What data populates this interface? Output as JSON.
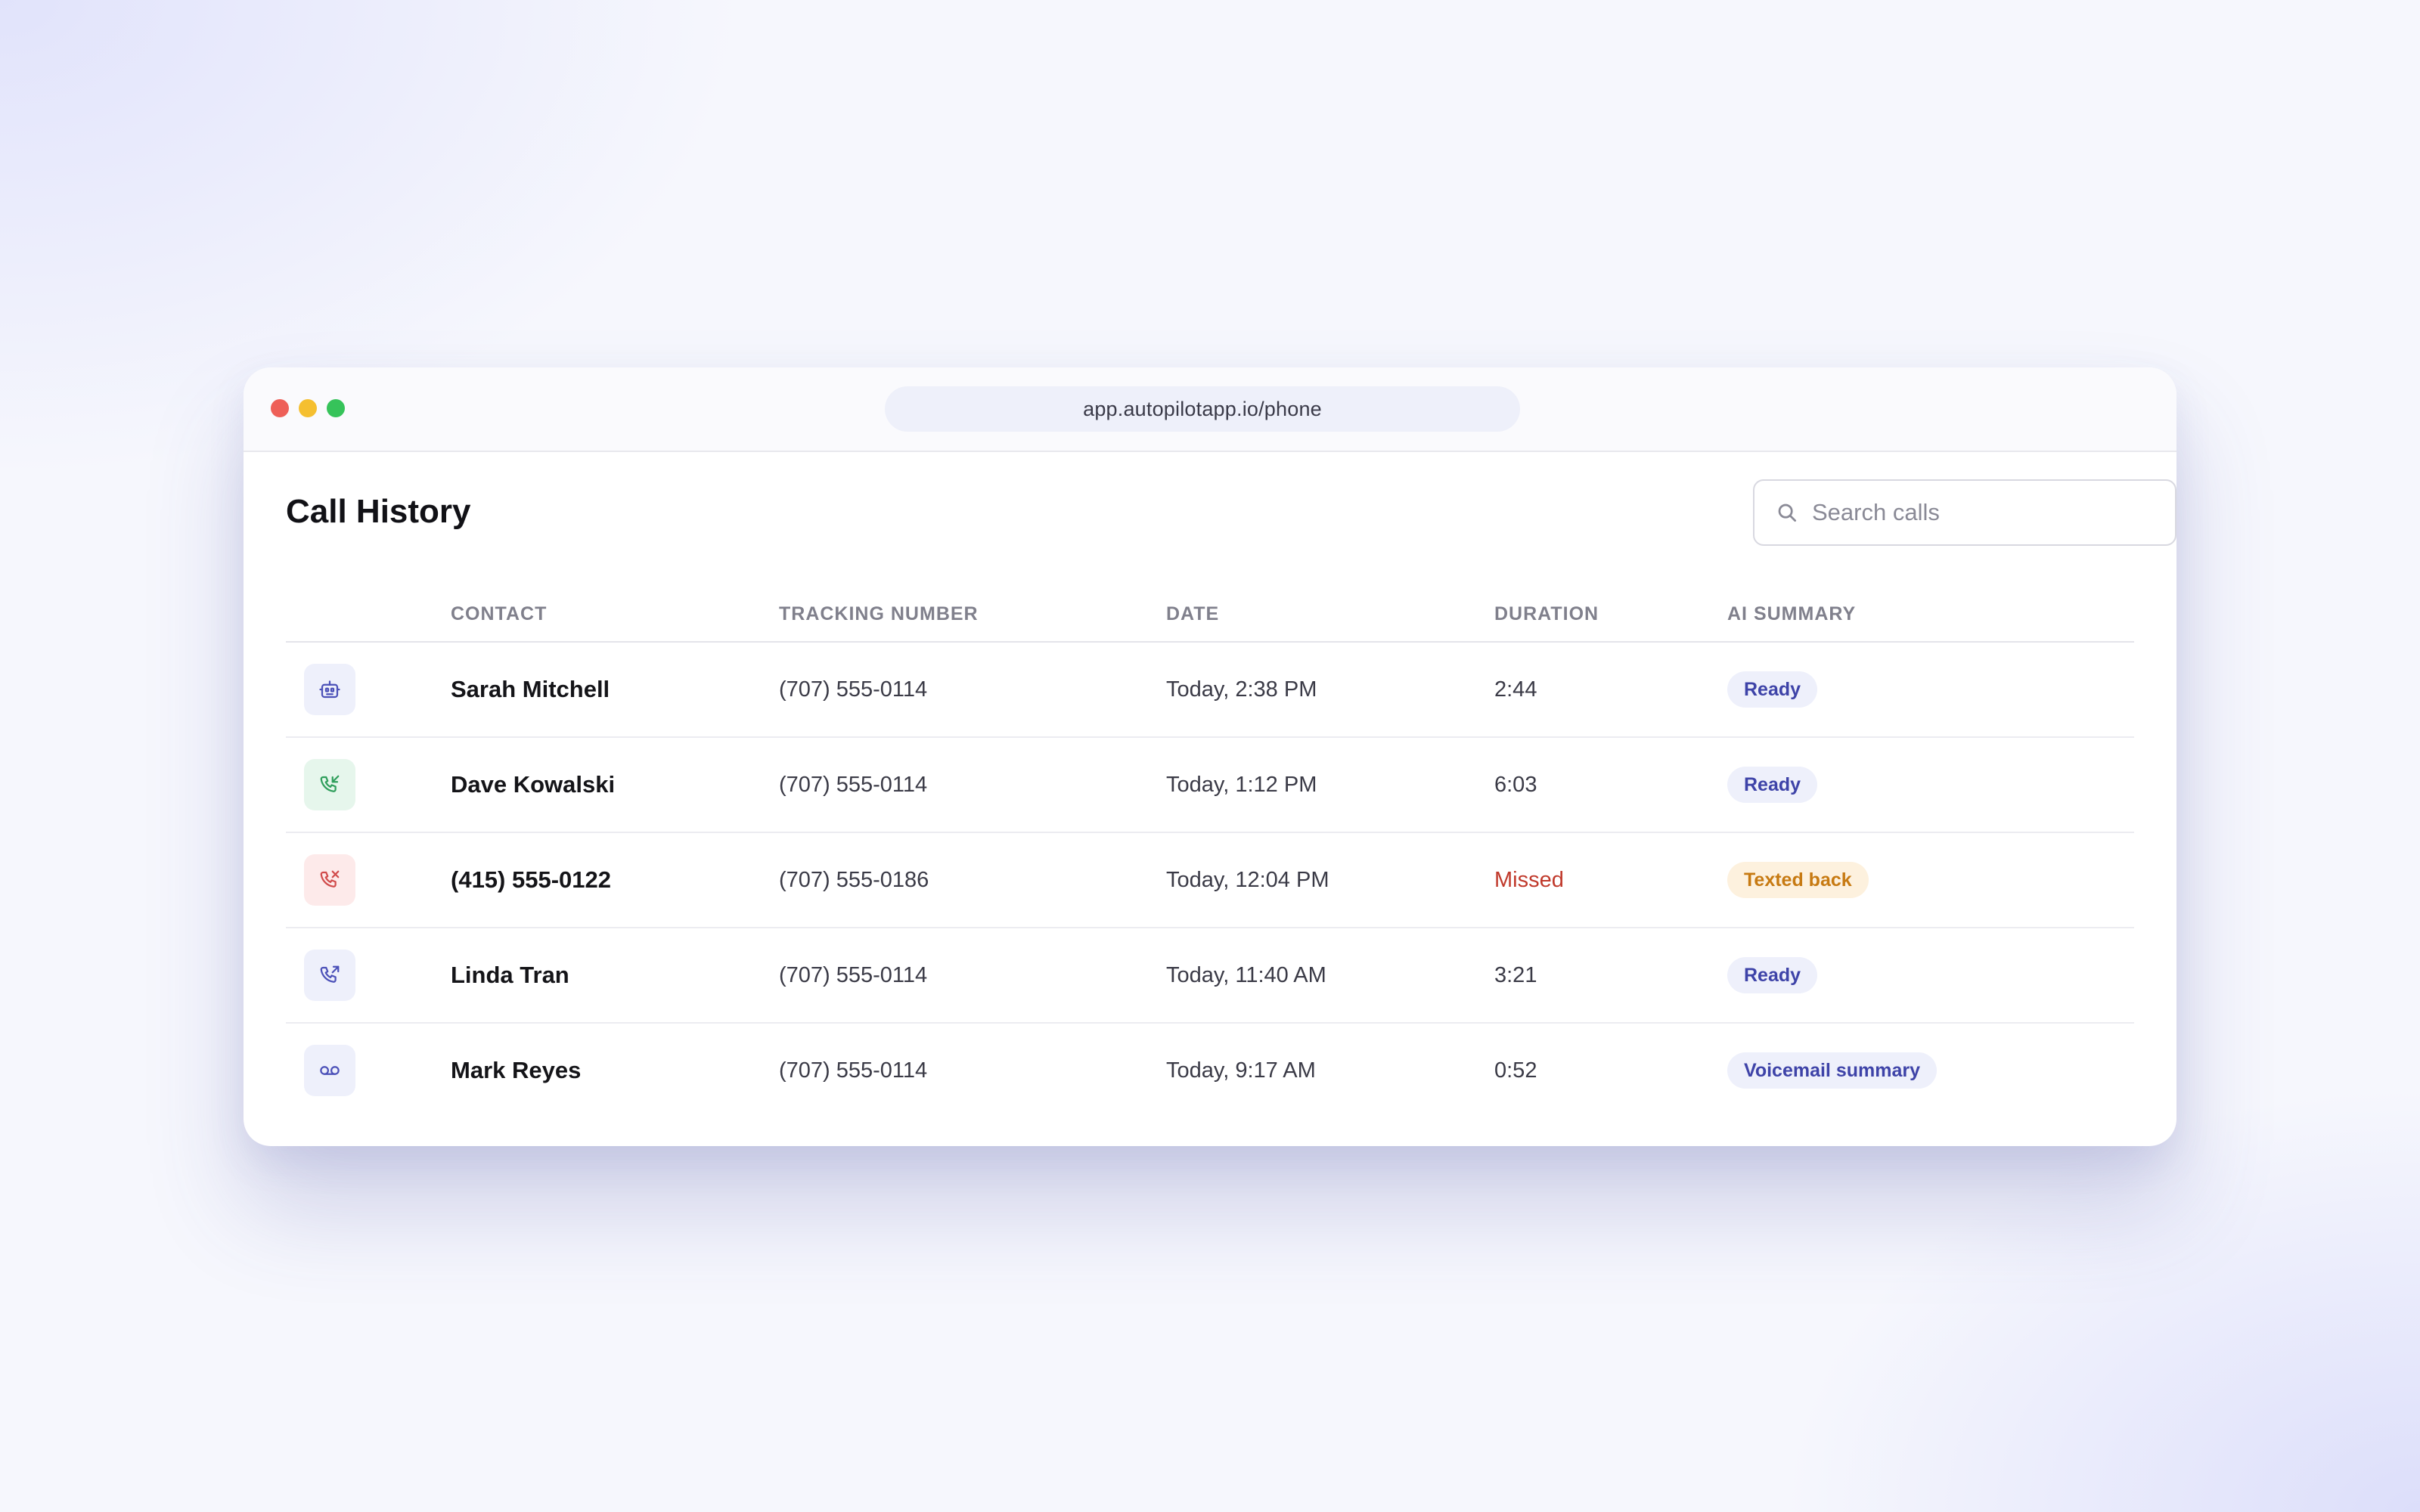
{
  "browser": {
    "url": "app.autopilotapp.io/phone"
  },
  "page": {
    "title": "Call History",
    "search_placeholder": "Search calls"
  },
  "table": {
    "headers": {
      "contact": "CONTACT",
      "tracking_number": "TRACKING NUMBER",
      "date": "DATE",
      "duration": "DURATION",
      "ai_summary": "AI SUMMARY"
    },
    "rows": [
      {
        "icon": "ai-bot-icon",
        "contact": "Sarah Mitchell",
        "tracking_number": "(707) 555-0114",
        "date": "Today, 2:38 PM",
        "duration": "2:44",
        "summary": "Ready",
        "status": "ready"
      },
      {
        "icon": "incoming-call-icon",
        "contact": "Dave Kowalski",
        "tracking_number": "(707) 555-0114",
        "date": "Today, 1:12 PM",
        "duration": "6:03",
        "summary": "Ready",
        "status": "ready"
      },
      {
        "icon": "missed-call-icon",
        "contact": "(415) 555-0122",
        "tracking_number": "(707) 555-0186",
        "date": "Today, 12:04 PM",
        "duration": "Missed",
        "summary": "Texted back",
        "status": "texted"
      },
      {
        "icon": "outgoing-call-icon",
        "contact": "Linda Tran",
        "tracking_number": "(707) 555-0114",
        "date": "Today, 11:40 AM",
        "duration": "3:21",
        "summary": "Ready",
        "status": "ready"
      },
      {
        "icon": "voicemail-icon",
        "contact": "Mark Reyes",
        "tracking_number": "(707) 555-0114",
        "date": "Today, 9:17 AM",
        "duration": "0:52",
        "summary": "Voicemail summary",
        "status": "voicemail"
      }
    ]
  },
  "colors": {
    "accent": "#3e43a8",
    "missed": "#c0392b",
    "incoming": "#2f9e5b",
    "warning": "#c77a12",
    "badge_indigo_bg": "#eef0fb",
    "badge_green_bg": "#e6f6ec",
    "badge_red_bg": "#fdeaea"
  }
}
